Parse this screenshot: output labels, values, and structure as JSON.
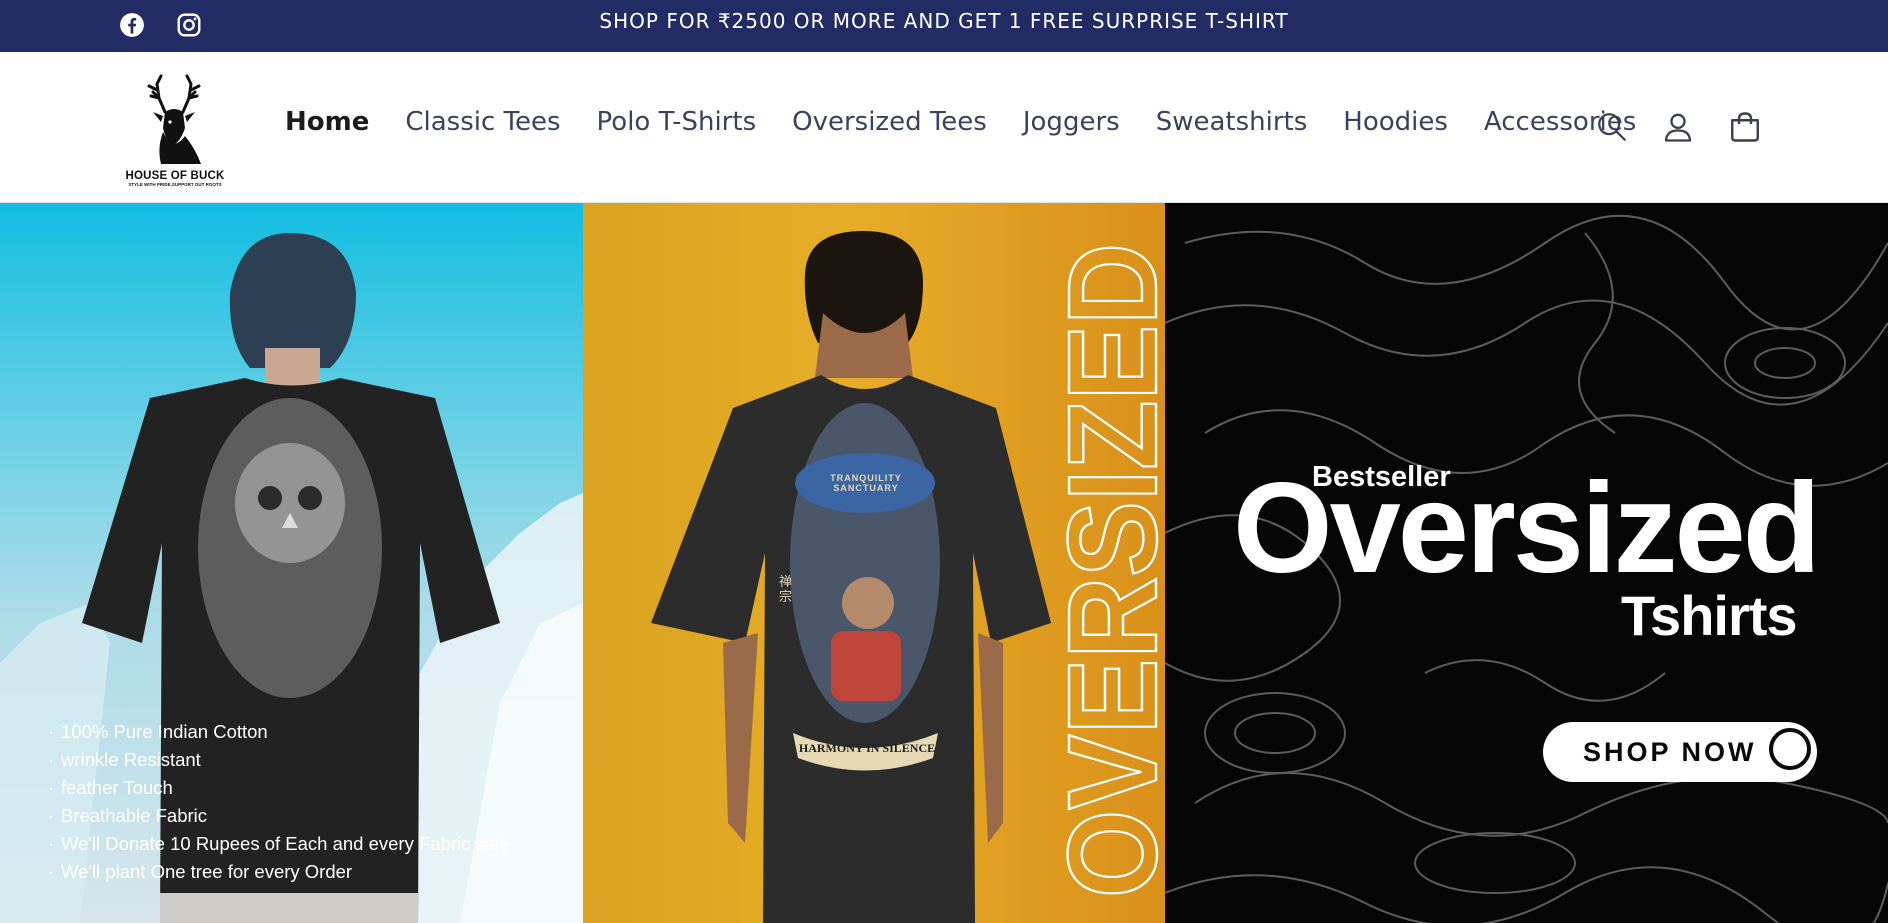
{
  "announcement": {
    "message": "SHOP FOR ₹2500 OR MORE AND GET 1 FREE SURPRISE T-SHIRT",
    "social": [
      {
        "name": "facebook-icon"
      },
      {
        "name": "instagram-icon"
      }
    ],
    "background": "#232b65"
  },
  "header": {
    "logo": {
      "brand": "HOUSE OF BUCK",
      "tagline": "STYLE WITH PRIDE,SUPPORT OUT ROOTS"
    },
    "nav": [
      {
        "label": "Home",
        "active": true
      },
      {
        "label": "Classic Tees",
        "active": false
      },
      {
        "label": "Polo T-Shirts",
        "active": false
      },
      {
        "label": "Oversized Tees",
        "active": false
      },
      {
        "label": "Joggers",
        "active": false
      },
      {
        "label": "Sweatshirts",
        "active": false
      },
      {
        "label": "Hoodies",
        "active": false
      },
      {
        "label": "Accessories",
        "active": false
      }
    ],
    "icons": [
      "search-icon",
      "account-icon",
      "cart-icon"
    ]
  },
  "hero": {
    "features": [
      "100% Pure Indian Cotton",
      "wrinkle Resistant",
      "feather Touch",
      "Breathable Fabric",
      "We'll Donate 10 Rupees of Each and every Fabric sale",
      "We'll plant One tree for every Order"
    ],
    "shirt1_print": "owl-graphic",
    "shirt2_print": {
      "top_text": "TRANQUILITY SANCTUARY",
      "banner_text": "HARMONY IN SILENCE",
      "side_text": "禅宗"
    },
    "vertical_text": "OVERSIZED",
    "promo": {
      "eyebrow": "Bestseller",
      "headline": "Oversized",
      "subline": "Tshirts",
      "cta": "SHOP NOW"
    },
    "colors": {
      "panel1_sky": "#12bde0",
      "panel2_yellow": "#e3a826",
      "panel3_black": "#060606"
    }
  }
}
